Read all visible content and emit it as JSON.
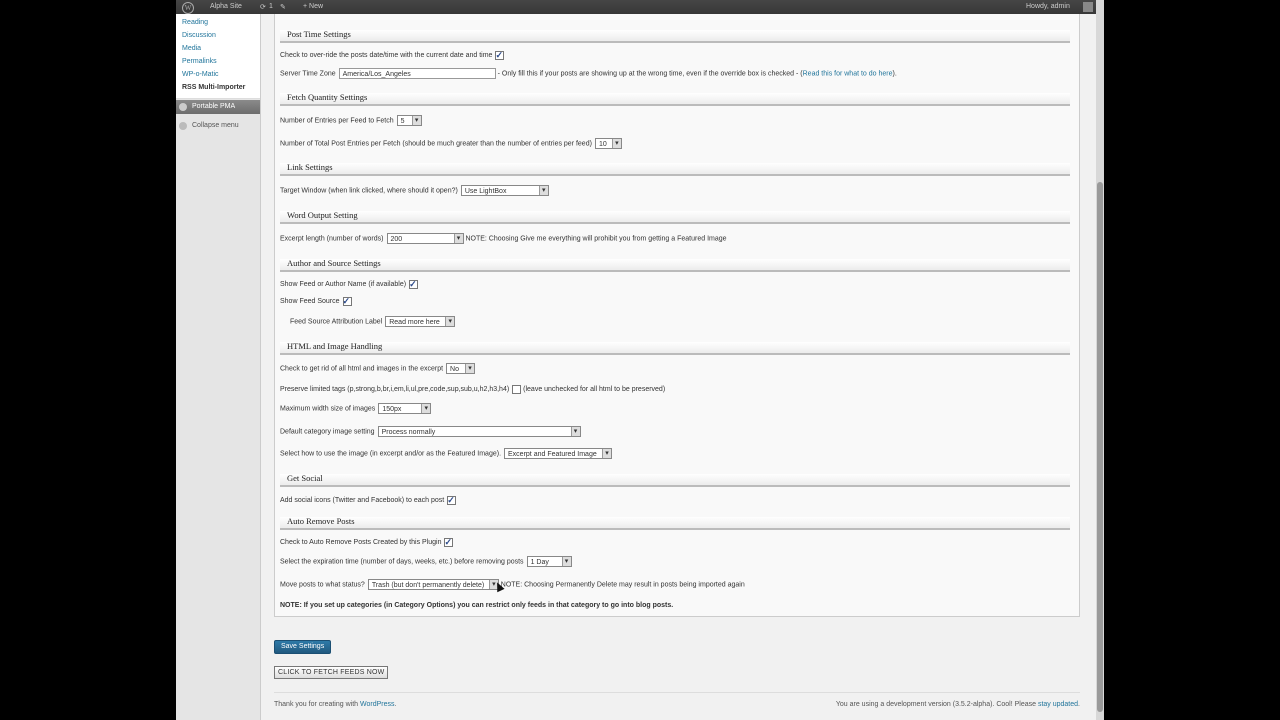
{
  "adminbar": {
    "logo_glyph": "W",
    "site_name": "Alpha Site",
    "updates_count": "1",
    "new_label": "+ New",
    "howdy": "Howdy, admin"
  },
  "sidebar": {
    "items": [
      "Reading",
      "Discussion",
      "Media",
      "Permalinks",
      "WP-o-Matic",
      "RSS Multi-Importer"
    ],
    "pma_label": "Portable PMA",
    "collapse_label": "Collapse menu"
  },
  "sections": {
    "post_time": "Post Time Settings",
    "fetch_qty": "Fetch Quantity Settings",
    "link": "Link Settings",
    "word_output": "Word Output Setting",
    "author_source": "Author and Source Settings",
    "html_image": "HTML and Image Handling",
    "social": "Get Social",
    "auto_remove": "Auto Remove Posts"
  },
  "fields": {
    "override_date": "Check to over-ride the posts date/time with the current date and time",
    "server_tz_label": "Server Time Zone",
    "server_tz_value": "America/Los_Angeles",
    "server_tz_note": "- Only fill this if your posts are showing up at the wrong time, even if the override box is checked - (",
    "server_tz_link": "Read this for what to do here",
    "server_tz_close": ").",
    "entries_per_feed": "Number of Entries per Feed to Fetch",
    "entries_per_feed_value": "5",
    "total_entries": "Number of Total Post Entries per Fetch (should be much greater than the number of entries per feed)",
    "total_entries_value": "10",
    "target_window": "Target Window (when link clicked, where should it open?)",
    "target_window_value": "Use LightBox",
    "excerpt_length": "Excerpt length (number of words)",
    "excerpt_length_value": "200",
    "excerpt_note": "NOTE: Choosing Give me everything will prohibit you from getting a Featured Image",
    "show_author": "Show Feed or Author Name (if available)",
    "show_source": "Show Feed Source",
    "attribution_label": "Feed Source Attribution Label",
    "attribution_value": "Read more here",
    "strip_html": "Check to get rid of all html and images in the excerpt",
    "strip_html_value": "No",
    "preserve_tags": "Preserve limited tags (p,strong,b,br,i,em,li,ul,pre,code,sup,sub,u,h2,h3,h4)",
    "preserve_tags_note": "(leave unchecked for all html to be preserved)",
    "max_width": "Maximum width size of images",
    "max_width_value": "150px",
    "default_cat_image": "Default category image setting",
    "default_cat_image_value": "Process normally",
    "use_image": "Select how to use the image (in excerpt and/or as the Featured Image).",
    "use_image_value": "Excerpt and Featured Image",
    "social_icons": "Add social icons (Twitter and Facebook) to each post",
    "auto_remove": "Check to Auto Remove Posts Created by this Plugin",
    "expiration": "Select the expiration time (number of days, weeks, etc.) before removing posts",
    "expiration_value": "1 Day",
    "move_status": "Move posts to what status?",
    "move_status_value": "Trash (but don't permanently delete)",
    "move_status_note": "NOTE: Choosing Permanently Delete may result in posts being imported again",
    "category_note": "NOTE: If you set up categories (in Category Options) you can restrict only feeds in that category to go into blog posts."
  },
  "buttons": {
    "save": "Save Settings",
    "fetch": "CLICK TO FETCH FEEDS NOW"
  },
  "footer": {
    "thanks_prefix": "Thank you for creating with ",
    "thanks_link": "WordPress",
    "thanks_suffix": ".",
    "version_text": "You are using a development version (3.5.2-alpha). Cool! Please ",
    "version_link": "stay updated",
    "version_suffix": "."
  }
}
